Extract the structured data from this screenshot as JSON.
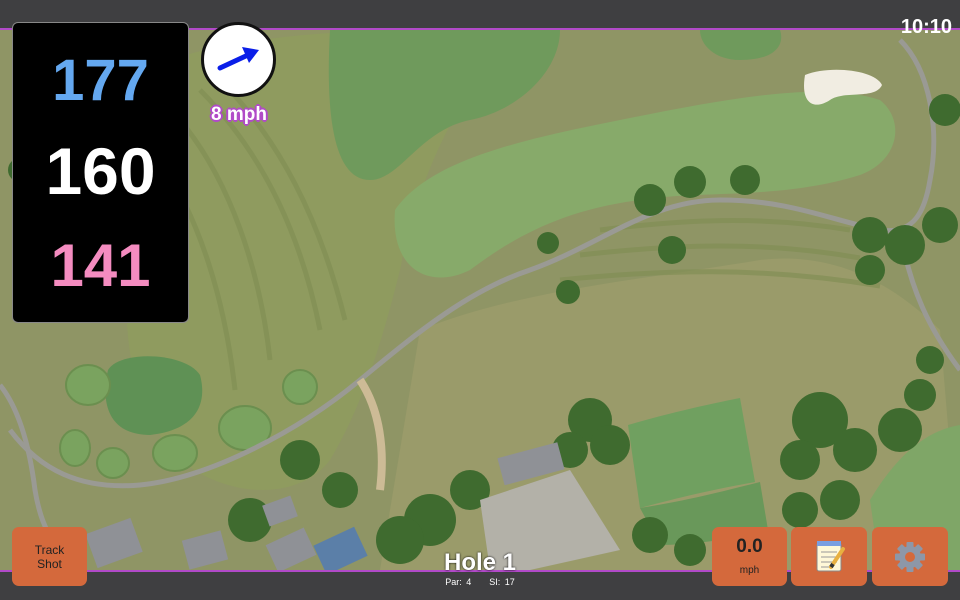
{
  "status_bar": {
    "time": "10:10"
  },
  "distances": {
    "back": "177",
    "middle": "160",
    "front": "141",
    "back_color": "#64a8f0",
    "middle_color": "#ffffff",
    "front_color": "#f48cc0"
  },
  "wind": {
    "speed_label": "8 mph",
    "direction_icon": "arrow-icon",
    "arrow_color": "#0a1ee8"
  },
  "buttons": {
    "track_shot": "Track\nShot",
    "speed_value": "0.0",
    "speed_unit": "mph",
    "notes_icon": "notepad-icon",
    "settings_icon": "gear-icon",
    "button_color": "#d4693c"
  },
  "hole": {
    "title": "Hole 1",
    "par_label": "Par: 4",
    "si_label": "SI: 17"
  },
  "theme": {
    "accent": "#b14ac8",
    "bar_bg": "#3f3f41"
  }
}
